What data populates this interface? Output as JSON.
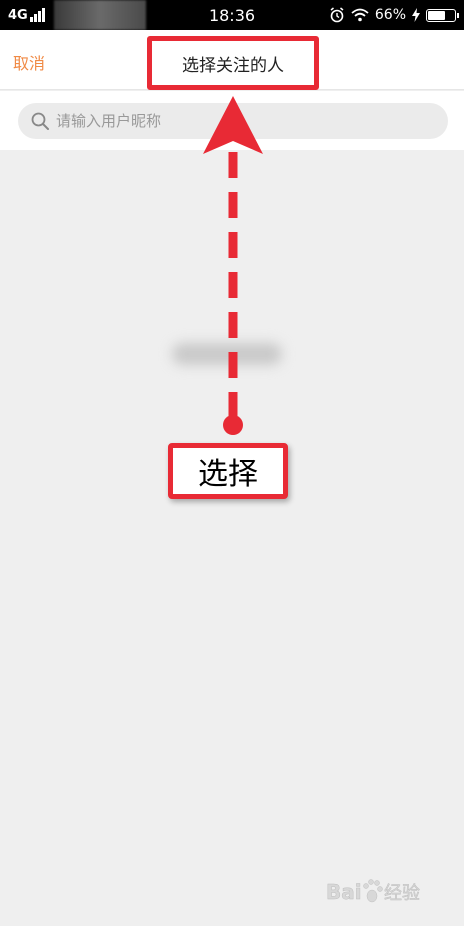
{
  "status_bar": {
    "network": "4G",
    "time": "18:36",
    "battery_percent": "66%",
    "battery_level": 0.66
  },
  "nav": {
    "cancel_label": "取消",
    "title": "选择关注的人"
  },
  "search": {
    "placeholder": "请输入用户昵称"
  },
  "annotation": {
    "label": "选择",
    "color": "#e82a35"
  },
  "watermark": {
    "brand": "Bai",
    "suffix": "经验"
  },
  "colors": {
    "accent": "#f08a45",
    "highlight": "#e82a35",
    "background": "#efefef"
  }
}
